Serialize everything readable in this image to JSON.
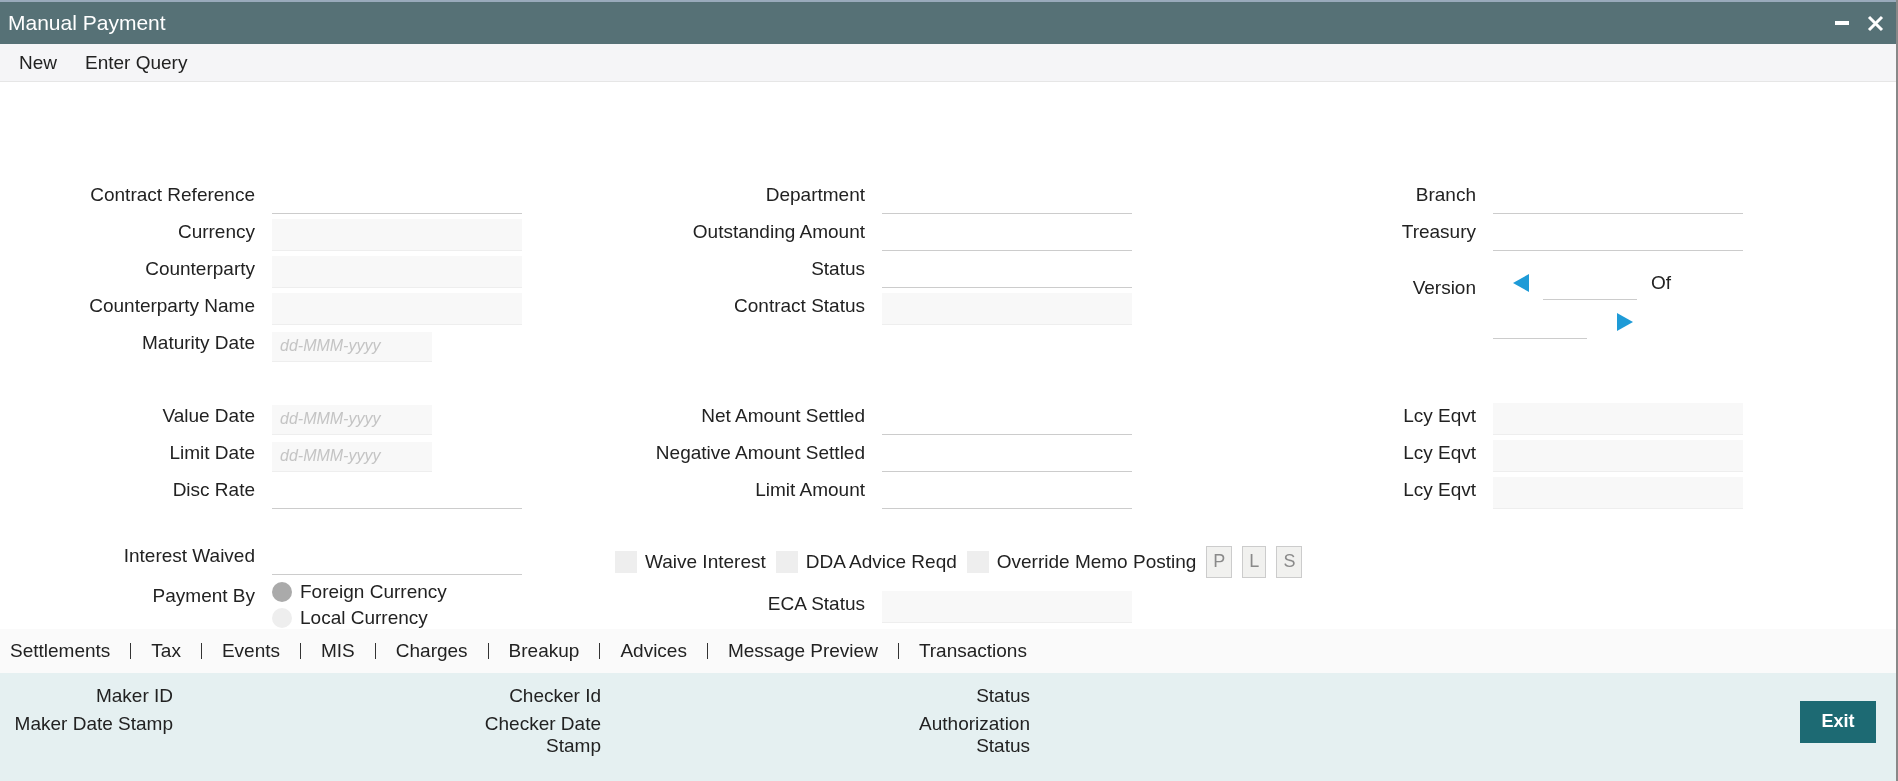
{
  "window": {
    "title": "Manual Payment"
  },
  "toolbar": [
    "New",
    "Enter Query"
  ],
  "columns": [
    {
      "sections": [
        [
          {
            "kind": "text",
            "label": "Contract Reference"
          },
          {
            "kind": "readonly",
            "label": "Currency"
          },
          {
            "kind": "readonly",
            "label": "Counterparty"
          },
          {
            "kind": "readonly",
            "label": "Counterparty Name"
          },
          {
            "kind": "date",
            "label": "Maturity Date",
            "placeholder": "dd-MMM-yyyy"
          }
        ],
        [
          {
            "kind": "date",
            "label": "Value Date",
            "placeholder": "dd-MMM-yyyy"
          },
          {
            "kind": "date",
            "label": "Limit Date",
            "placeholder": "dd-MMM-yyyy"
          },
          {
            "kind": "text",
            "label": "Disc Rate"
          }
        ],
        [
          {
            "kind": "text",
            "label": "Interest Waived"
          },
          {
            "kind": "radio",
            "label": "Payment By",
            "options": [
              {
                "label": "Foreign Currency",
                "selected": true
              },
              {
                "label": "Local Currency",
                "selected": false
              }
            ]
          }
        ]
      ]
    },
    {
      "sections": [
        [
          {
            "kind": "text",
            "label": "Department"
          },
          {
            "kind": "text",
            "label": "Outstanding Amount"
          },
          {
            "kind": "text",
            "label": "Status"
          },
          {
            "kind": "readonly",
            "label": "Contract Status"
          }
        ],
        [
          {
            "kind": "text",
            "label": "Net Amount Settled"
          },
          {
            "kind": "text",
            "label": "Negative Amount Settled"
          },
          {
            "kind": "text",
            "label": "Limit Amount"
          }
        ],
        [
          {
            "kind": "checks",
            "items": [
              {
                "label": "Waive Interest",
                "checked": false
              },
              {
                "label": "DDA Advice Reqd",
                "checked": false
              },
              {
                "label": "Override Memo Posting",
                "checked": false
              }
            ],
            "buttons": [
              {
                "label": "P",
                "disabled": true
              },
              {
                "label": "L",
                "disabled": true
              },
              {
                "label": "S",
                "disabled": true
              }
            ]
          },
          {
            "kind": "readonly",
            "label": "ECA Status"
          }
        ]
      ]
    },
    {
      "sections": [
        [
          {
            "kind": "text",
            "label": "Branch"
          },
          {
            "kind": "text",
            "label": "Treasury"
          },
          {
            "kind": "version",
            "label": "Version",
            "of_label": "Of"
          }
        ],
        [
          {
            "kind": "readonly",
            "label": "Lcy Eqvt"
          },
          {
            "kind": "readonly",
            "label": "Lcy Eqvt"
          },
          {
            "kind": "readonly",
            "label": "Lcy Eqvt"
          }
        ]
      ]
    }
  ],
  "tabs": [
    "Settlements",
    "Tax",
    "Events",
    "MIS",
    "Charges",
    "Breakup",
    "Advices",
    "Message Preview",
    "Transactions"
  ],
  "audit": [
    {
      "label": "Maker ID"
    },
    {
      "label": "Maker Date Stamp"
    },
    {
      "label": "Checker Id"
    },
    {
      "label": "Checker Date Stamp"
    },
    {
      "label": "Status"
    },
    {
      "label": "Authorization Status"
    }
  ],
  "exit_button": "Exit"
}
